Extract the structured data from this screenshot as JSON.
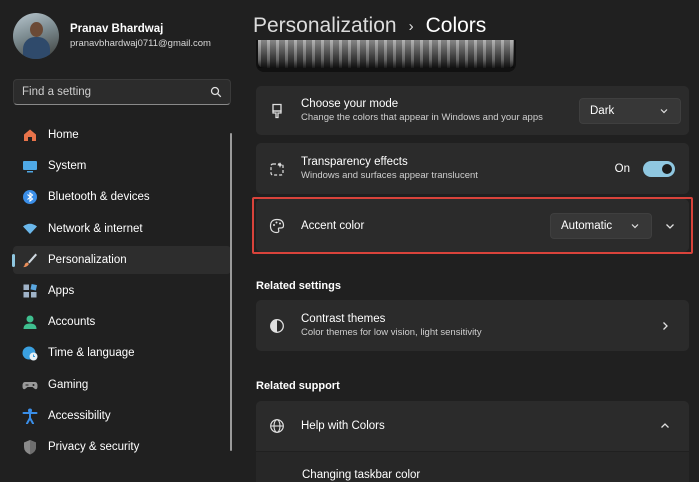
{
  "profile": {
    "name": "Pranav Bhardwaj",
    "email": "pranavbhardwaj0711@gmail.com"
  },
  "search": {
    "placeholder": "Find a setting",
    "icon": "search-icon"
  },
  "sidebar": {
    "items": [
      {
        "label": "Home",
        "icon": "home-icon",
        "color": "#e8734a"
      },
      {
        "label": "System",
        "icon": "monitor-icon",
        "color": "#4fa9e6"
      },
      {
        "label": "Bluetooth & devices",
        "icon": "bluetooth-icon",
        "color": "#3a8ee8"
      },
      {
        "label": "Network & internet",
        "icon": "wifi-icon",
        "color": "#6ab7ea"
      },
      {
        "label": "Personalization",
        "icon": "brush-icon",
        "color": "#e98e5a",
        "active": true
      },
      {
        "label": "Apps",
        "icon": "apps-icon",
        "color": "#9fb3c8"
      },
      {
        "label": "Accounts",
        "icon": "person-icon",
        "color": "#3fbf8f"
      },
      {
        "label": "Time & language",
        "icon": "globe-clock-icon",
        "color": "#3aa0e0"
      },
      {
        "label": "Gaming",
        "icon": "gamepad-icon",
        "color": "#9a9a9a"
      },
      {
        "label": "Accessibility",
        "icon": "accessibility-icon",
        "color": "#3a8ee8"
      },
      {
        "label": "Privacy & security",
        "icon": "shield-icon",
        "color": "#8a8a8a"
      }
    ]
  },
  "breadcrumb": {
    "parent": "Personalization",
    "separator": "›",
    "current": "Colors"
  },
  "mode": {
    "title": "Choose your mode",
    "subtitle": "Change the colors that appear in Windows and your apps",
    "value": "Dark",
    "icon": "paintbrush-icon"
  },
  "transparency": {
    "title": "Transparency effects",
    "subtitle": "Windows and surfaces appear translucent",
    "state": "On",
    "icon": "sparkle-icon"
  },
  "accent": {
    "title": "Accent color",
    "value": "Automatic",
    "icon": "palette-icon"
  },
  "related_settings": {
    "heading": "Related settings",
    "contrast": {
      "title": "Contrast themes",
      "subtitle": "Color themes for low vision, light sensitivity",
      "icon": "contrast-icon"
    }
  },
  "related_support": {
    "heading": "Related support",
    "help": {
      "title": "Help with Colors",
      "icon": "globe-icon"
    },
    "link": "Changing taskbar color"
  },
  "colors": {
    "accent": "#8fc7e0",
    "highlight": "#d9433b",
    "background": "#202020",
    "card": "#2b2b2b"
  }
}
